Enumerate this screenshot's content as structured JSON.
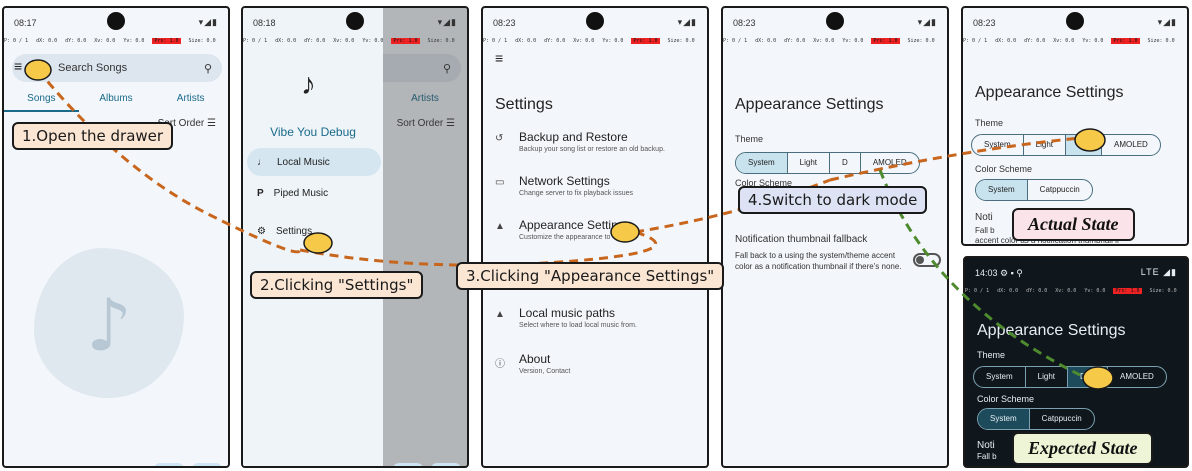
{
  "debug": {
    "p": "P: 0 / 1",
    "dx": "dX: 0.0",
    "dy": "dY: 0.0",
    "xv": "Xv: 0.0",
    "yv": "Yv: 0.0",
    "prs": "Prs: 1.0",
    "size": "Size: 0.0"
  },
  "screen1": {
    "time": "08:17",
    "search_placeholder": "Search Songs",
    "tabs": [
      "Songs",
      "Albums",
      "Artists"
    ],
    "sort": "Sort Order"
  },
  "screen2": {
    "time": "08:18",
    "app_name": "Vibe You Debug",
    "items": [
      "Local Music",
      "Piped Music",
      "Settings"
    ],
    "artists_tab": "Artists",
    "sort": "Sort Order"
  },
  "screen3": {
    "time": "08:23",
    "title": "Settings",
    "items": [
      {
        "title": "Backup and Restore",
        "sub": "Backup your song list or restore an old backup."
      },
      {
        "title": "Network Settings",
        "sub": "Change server to fix playback issues"
      },
      {
        "title": "Appearance Settings",
        "sub": "Customize the appearance to"
      },
      {
        "title": "Local music paths",
        "sub": "Select where to load local music from."
      },
      {
        "title": "About",
        "sub": "Version, Contact"
      }
    ]
  },
  "screen4": {
    "time": "08:23",
    "title": "Appearance Settings",
    "theme_label": "Theme",
    "theme_options": [
      "System",
      "Light",
      "D",
      "AMOLED"
    ],
    "scheme_label": "Color Scheme",
    "notif_title": "Notification thumbnail fallback",
    "notif_desc": "Fall back to a using the system/theme accent color as a notification thumbnail if there's none."
  },
  "screen5": {
    "time": "08:23",
    "title": "Appearance Settings",
    "theme_label": "Theme",
    "theme_options": [
      "System",
      "Light",
      "",
      "AMOLED"
    ],
    "scheme_label": "Color Scheme",
    "scheme_options": [
      "System",
      "Catppuccin"
    ],
    "notif_partial": "Noti",
    "notif_line1": "Fall b",
    "notif_line2": "accent color as a notification thumbnail if"
  },
  "screen6": {
    "time": "14:03",
    "network": "LTE",
    "title": "Appearance Settings",
    "theme_label": "Theme",
    "theme_options": [
      "System",
      "Light",
      "D",
      "AMOLED"
    ],
    "scheme_label": "Color Scheme",
    "scheme_options": [
      "System",
      "Catppuccin"
    ],
    "notif_partial": "Noti",
    "notif_line1": "Fall b"
  },
  "callouts": {
    "step1": "1.Open the drawer",
    "step2": "2.Clicking \"Settings\"",
    "step3": "3.Clicking \"Appearance Settings\"",
    "step4": "4.Switch to dark mode",
    "actual": "Actual State",
    "expected": "Expected State"
  },
  "colors": {
    "accent": "#1b6a8a",
    "arrow_orange": "#c8661e",
    "arrow_green": "#4e8a2e",
    "actual_bg": "#fbe3ea",
    "expected_bg": "#eef5d6",
    "callout_bg": "#fbe6d4",
    "callout4_bg": "#dde3f4"
  }
}
